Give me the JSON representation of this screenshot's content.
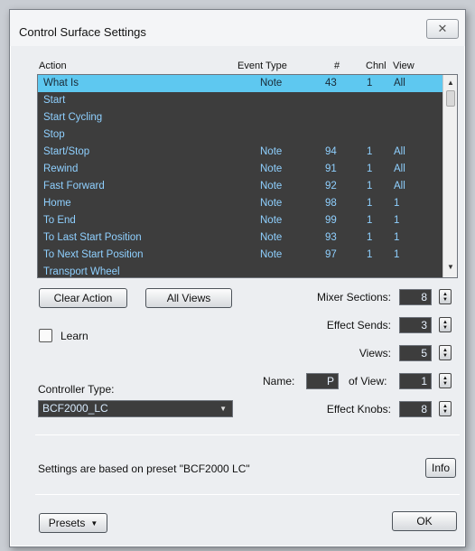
{
  "window": {
    "title": "Control Surface Settings",
    "close_glyph": "✕"
  },
  "columns": {
    "action": "Action",
    "event_type": "Event Type",
    "number": "#",
    "channel": "Chnl",
    "view": "View"
  },
  "rows": [
    {
      "action": "What Is",
      "event": "Note",
      "num": "43",
      "chnl": "1",
      "view": "All",
      "selected": true
    },
    {
      "action": "Start",
      "event": "",
      "num": "",
      "chnl": "",
      "view": ""
    },
    {
      "action": "Start Cycling",
      "event": "",
      "num": "",
      "chnl": "",
      "view": ""
    },
    {
      "action": "Stop",
      "event": "",
      "num": "",
      "chnl": "",
      "view": ""
    },
    {
      "action": "Start/Stop",
      "event": "Note",
      "num": "94",
      "chnl": "1",
      "view": "All"
    },
    {
      "action": "Rewind",
      "event": "Note",
      "num": "91",
      "chnl": "1",
      "view": "All"
    },
    {
      "action": "Fast Forward",
      "event": "Note",
      "num": "92",
      "chnl": "1",
      "view": "All"
    },
    {
      "action": "Home",
      "event": "Note",
      "num": "98",
      "chnl": "1",
      "view": "1"
    },
    {
      "action": "To End",
      "event": "Note",
      "num": "99",
      "chnl": "1",
      "view": "1"
    },
    {
      "action": "To Last Start Position",
      "event": "Note",
      "num": "93",
      "chnl": "1",
      "view": "1"
    },
    {
      "action": "To Next Start Position",
      "event": "Note",
      "num": "97",
      "chnl": "1",
      "view": "1"
    },
    {
      "action": "Transport Wheel",
      "event": "",
      "num": "",
      "chnl": "",
      "view": ""
    }
  ],
  "buttons": {
    "clear_action": "Clear Action",
    "all_views": "All Views",
    "info": "Info",
    "presets": "Presets",
    "ok": "OK"
  },
  "learn": {
    "label": "Learn",
    "checked": false
  },
  "controller": {
    "label": "Controller Type:",
    "value": "BCF2000_LC"
  },
  "fields": {
    "mixer_sections": {
      "label": "Mixer Sections:",
      "value": "8"
    },
    "effect_sends": {
      "label": "Effect Sends:",
      "value": "3"
    },
    "views": {
      "label": "Views:",
      "value": "5"
    },
    "name": {
      "label": "Name:",
      "value": "P"
    },
    "of_view": {
      "label": "of View:",
      "value": "1"
    },
    "effect_knobs": {
      "label": "Effect Knobs:",
      "value": "8"
    }
  },
  "status": "Settings are based on preset \"BCF2000 LC\"",
  "colors": {
    "list_bg": "#3d3d3d",
    "row_text": "#8fd0ff",
    "selection": "#5ec8f0"
  }
}
